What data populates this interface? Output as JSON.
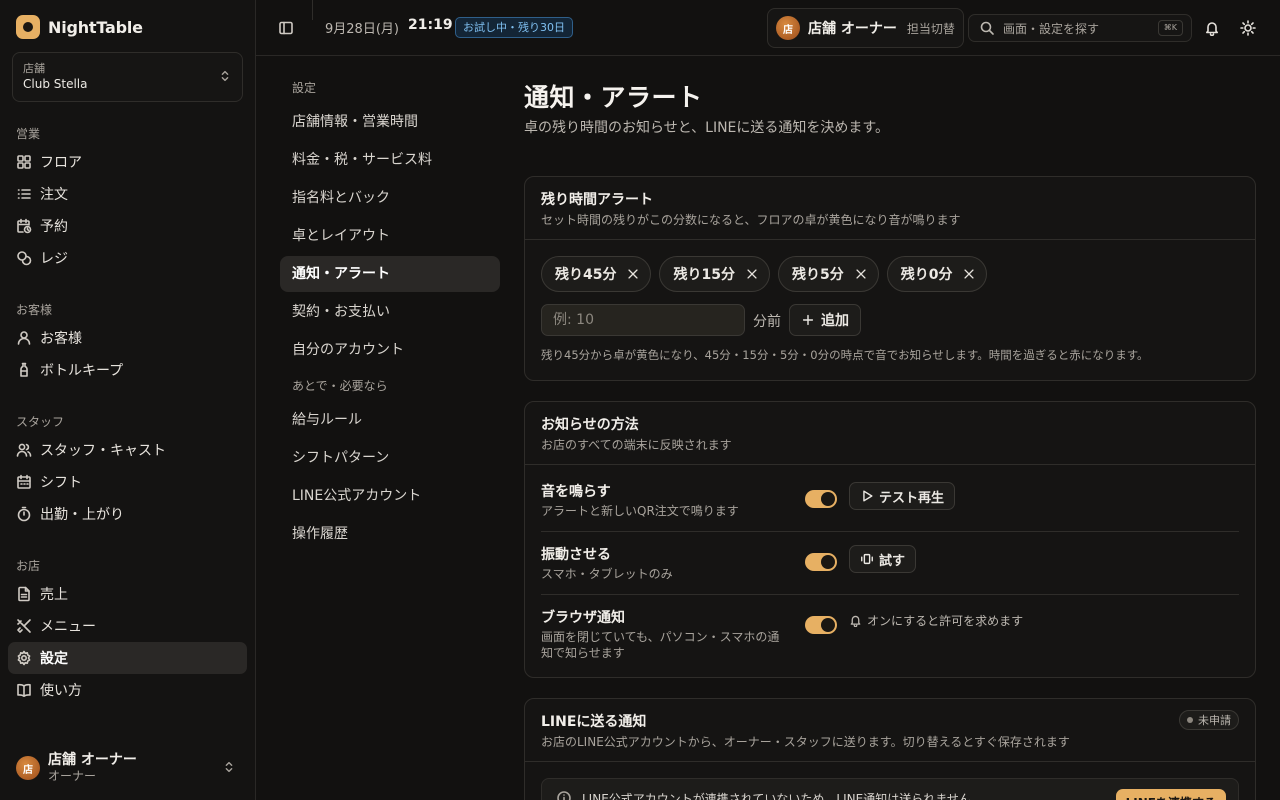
{
  "brand": {
    "name": "NightTable"
  },
  "store": {
    "label": "店舗",
    "value": "Club Stella"
  },
  "sidebar": {
    "sections": [
      {
        "heading": "営業",
        "items": [
          {
            "label": "フロア",
            "icon": "grid-icon"
          },
          {
            "label": "注文",
            "icon": "list-icon"
          },
          {
            "label": "予約",
            "icon": "calendar-clock-icon"
          },
          {
            "label": "レジ",
            "icon": "coins-icon"
          }
        ]
      },
      {
        "heading": "お客様",
        "items": [
          {
            "label": "お客様",
            "icon": "user-icon"
          },
          {
            "label": "ボトルキープ",
            "icon": "bottle-icon"
          }
        ]
      },
      {
        "heading": "スタッフ",
        "items": [
          {
            "label": "スタッフ・キャスト",
            "icon": "users-icon"
          },
          {
            "label": "シフト",
            "icon": "calendar-icon"
          },
          {
            "label": "出勤・上がり",
            "icon": "timer-icon"
          }
        ]
      },
      {
        "heading": "お店",
        "items": [
          {
            "label": "売上",
            "icon": "document-icon"
          },
          {
            "label": "メニュー",
            "icon": "utensils-icon"
          },
          {
            "label": "設定",
            "icon": "gear-icon",
            "active": true
          },
          {
            "label": "使い方",
            "icon": "book-icon"
          }
        ]
      }
    ]
  },
  "user": {
    "avatar": "店",
    "name": "店舗 オーナー",
    "role": "オーナー"
  },
  "topbar": {
    "date": "9月28日(月)",
    "time": "21:19",
    "trial": "お試し中・残り30日",
    "owner_avatar": "店",
    "owner_name": "店舗 オーナー",
    "switch_label": "担当切替",
    "search_placeholder": "画面・設定を探す",
    "search_shortcut": "⌘K"
  },
  "subnav": {
    "heading1": "設定",
    "items1": [
      "店舗情報・営業時間",
      "料金・税・サービス料",
      "指名料とバック",
      "卓とレイアウト",
      "通知・アラート",
      "契約・お支払い",
      "自分のアカウント"
    ],
    "active": "通知・アラート",
    "heading2": "あとで・必要なら",
    "items2": [
      "給与ルール",
      "シフトパターン",
      "LINE公式アカウント",
      "操作履歴"
    ]
  },
  "page": {
    "title": "通知・アラート",
    "subtitle": "卓の残り時間のお知らせと、LINEに送る通知を決めます。"
  },
  "alerts_card": {
    "title": "残り時間アラート",
    "desc": "セット時間の残りがこの分数になると、フロアの卓が黄色になり音が鳴ります",
    "chips": [
      "残り45分",
      "残り15分",
      "残り5分",
      "残り0分"
    ],
    "input_placeholder": "例: 10",
    "unit": "分前",
    "add_label": "追加",
    "note": "残り45分から卓が黄色になり、45分・15分・5分・0分の時点で音でお知らせします。時間を過ぎると赤になります。"
  },
  "method_card": {
    "title": "お知らせの方法",
    "desc": "お店のすべての端末に反映されます",
    "sound": {
      "title": "音を鳴らす",
      "desc": "アラートと新しいQR注文で鳴ります",
      "on": true,
      "button": "テスト再生"
    },
    "vibrate": {
      "title": "振動させる",
      "desc": "スマホ・タブレットのみ",
      "on": true,
      "button": "試す"
    },
    "browser": {
      "title": "ブラウザ通知",
      "desc": "画面を閉じていても、パソコン・スマホの通知で知らせます",
      "on": true,
      "hint": "オンにすると許可を求めます"
    }
  },
  "line_card": {
    "title": "LINEに送る通知",
    "desc": "お店のLINE公式アカウントから、オーナー・スタッフに送ります。切り替えるとすぐ保存されます",
    "status": "未申請",
    "banner": "LINE公式アカウントが連携されていないため、LINE通知は送られません",
    "banner_button": "LINEを連携する"
  },
  "colors": {
    "accent": "#e7b063",
    "bg": "#121110",
    "panel": "#151413",
    "trial_text": "#7fbff0"
  }
}
